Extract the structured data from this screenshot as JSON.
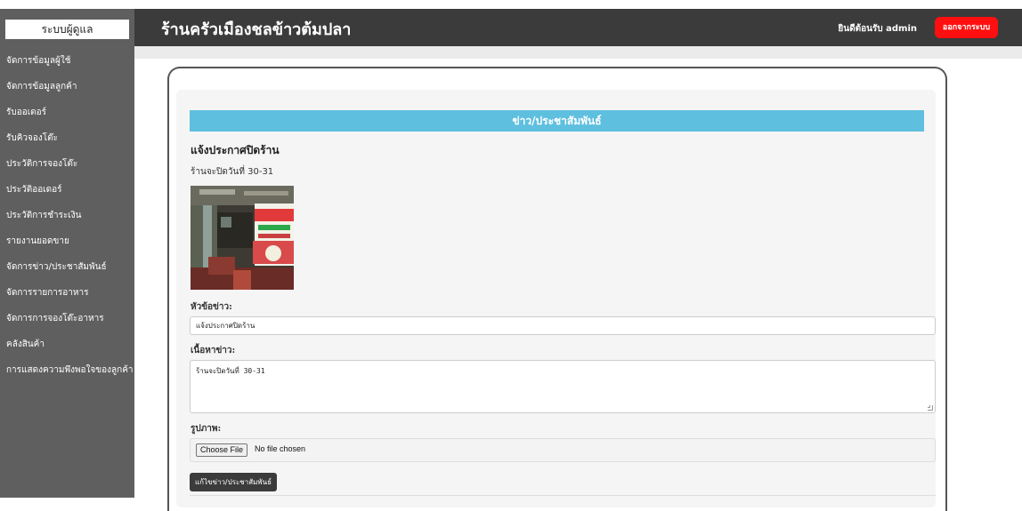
{
  "sidebar": {
    "title": "ระบบผู้ดูแล",
    "items": [
      {
        "label": "จัดการข้อมูลผู้ใช้"
      },
      {
        "label": "จัดการข้อมูลลูกค้า"
      },
      {
        "label": "รับออเดอร์"
      },
      {
        "label": "รับคิวจองโต๊ะ"
      },
      {
        "label": "ประวัติการจองโต๊ะ"
      },
      {
        "label": "ประวัติออเดอร์"
      },
      {
        "label": "ประวัติการชำระเงิน"
      },
      {
        "label": "รายงานยอดขาย"
      },
      {
        "label": "จัดการข่าว/ประชาสัมพันธ์"
      },
      {
        "label": "จัดการรายการอาหาร"
      },
      {
        "label": "จัดการการจองโต๊ะอาหาร"
      },
      {
        "label": "คลังสินค้า"
      },
      {
        "label": "การแสดงความพึงพอใจของลูกค้า"
      }
    ]
  },
  "header": {
    "title": "ร้านครัวเมืองชลข้าวต้มปลา",
    "welcome": "ยินดีต้อนรับ admin",
    "logout_label": "ออกจากระบบ"
  },
  "section": {
    "title": "ข่าว/ประชาสัมพันธ์"
  },
  "news": {
    "title": "แจ้งประกาศปิดร้าน",
    "body": "ร้านจะปิดวันที่ 30-31",
    "image_icon": "restaurant-photo"
  },
  "form": {
    "title_label": "หัวข้อข่าว:",
    "title_value": "แจ้งประกาศปิดร้าน",
    "content_label": "เนื้อหาข่าว:",
    "content_value": "ร้านจะปิดวันที่ 30-31",
    "image_label": "รูปภาพ:",
    "file_button": "Choose File",
    "file_status": "No file chosen",
    "submit_label": "แก้ไขข่าว/ประชาสัมพันธ์"
  },
  "colors": {
    "sidebar_bg": "#5f5f5f",
    "header_bg": "#3b3b3b",
    "accent": "#5ebfdf",
    "logout": "#ff0f0f"
  }
}
